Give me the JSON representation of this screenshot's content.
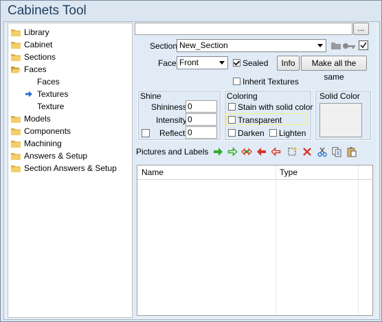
{
  "window": {
    "title": "Cabinets Tool"
  },
  "tree": {
    "items": [
      {
        "label": "Library",
        "type": "folder"
      },
      {
        "label": "Cabinet",
        "type": "folder"
      },
      {
        "label": "Sections",
        "type": "folder"
      },
      {
        "label": "Faces",
        "type": "folder-open"
      },
      {
        "label": "Faces",
        "type": "child"
      },
      {
        "label": "Textures",
        "type": "child-selected"
      },
      {
        "label": "Texture",
        "type": "child"
      },
      {
        "label": "Models",
        "type": "folder"
      },
      {
        "label": "Components",
        "type": "folder"
      },
      {
        "label": "Machining",
        "type": "folder"
      },
      {
        "label": "Answers & Setup",
        "type": "folder"
      },
      {
        "label": "Section Answers & Setup",
        "type": "folder"
      }
    ]
  },
  "top": {
    "path_value": "",
    "browse_label": "..."
  },
  "section": {
    "label": "Section:",
    "value": "New_Section"
  },
  "face": {
    "label": "Face:",
    "value": "Front",
    "sealed_label": "Sealed",
    "sealed_checked": true,
    "info_label": "Info",
    "same_label": "Make all the same"
  },
  "inherit": {
    "label": "Inherit Textures",
    "checked": false
  },
  "shine": {
    "title": "Shine",
    "shininess_label": "Shininess:",
    "shininess_value": "0",
    "intensity_label": "Intensity:",
    "intensity_value": "0",
    "reflect_label": "Reflect:",
    "reflect_value": "0"
  },
  "coloring": {
    "title": "Coloring",
    "stain_label": "Stain with solid color",
    "transparent_label": "Transparent",
    "darken_label": "Darken",
    "lighten_label": "Lighten"
  },
  "solid_color": {
    "title": "Solid Color",
    "swatch": "#f0f0f0"
  },
  "pictures": {
    "title": "Pictures and Labels",
    "toolbar_icons": [
      "arrow-right-solid-icon",
      "arrow-right-outline-icon",
      "arrow-left-right-icon",
      "arrow-left-solid-icon",
      "arrow-left-outline-icon",
      "select-rect-icon",
      "delete-icon",
      "cut-icon",
      "copy-icon",
      "paste-icon"
    ],
    "columns": [
      "Name",
      "Type"
    ]
  },
  "colors": {
    "folder": "#e8c15a",
    "green_arrow": "#2eaa2e",
    "red_arrow": "#d9342b",
    "selected_arrow": "#2f6fd6"
  }
}
